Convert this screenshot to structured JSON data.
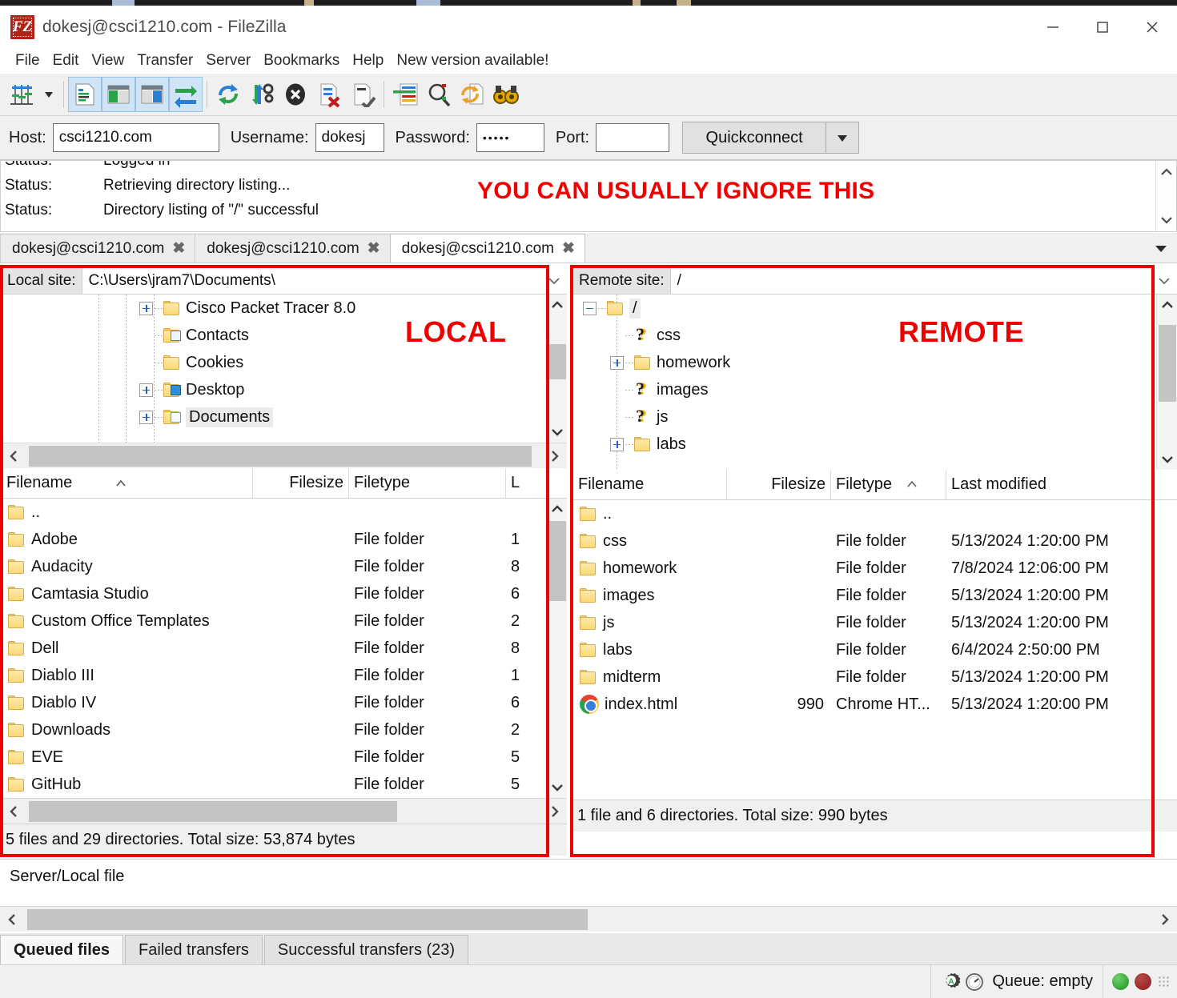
{
  "window": {
    "title": "dokesj@csci1210.com - FileZilla",
    "logo_text": "FZ",
    "minimize": "minimize-icon",
    "maximize": "maximize-icon",
    "close": "close-icon"
  },
  "menu": {
    "items": [
      "File",
      "Edit",
      "View",
      "Transfer",
      "Server",
      "Bookmarks",
      "Help",
      "New version available!"
    ]
  },
  "toolbar": {
    "icons": [
      "site-manager-icon",
      "site-manager-dropdown-caret",
      "toggle-message-log-icon",
      "toggle-local-tree-icon",
      "toggle-remote-tree-icon",
      "toggle-transfer-queue-icon",
      "refresh-icon",
      "process-queue-icon",
      "cancel-icon",
      "disconnect-icon",
      "reconnect-icon",
      "filter-icon",
      "compare-directories-icon",
      "synchronized-browsing-icon",
      "find-files-icon"
    ]
  },
  "quickconnect": {
    "host_label": "Host:",
    "host_value": "csci1210.com",
    "username_label": "Username:",
    "username_value": "dokesj",
    "password_label": "Password:",
    "password_value": "•••••",
    "port_label": "Port:",
    "port_value": "",
    "port_placeholder": "",
    "button_label": "Quickconnect",
    "dropdown_icon": "chevron-down-icon"
  },
  "status_log": {
    "rows": [
      {
        "key": "Status:",
        "msg": "Logged in"
      },
      {
        "key": "Status:",
        "msg": "Retrieving directory listing..."
      },
      {
        "key": "Status:",
        "msg": "Directory listing of \"/\" successful"
      }
    ],
    "annotation": "YOU CAN USUALLY IGNORE THIS",
    "annotation_color": "#f20000"
  },
  "tabs": {
    "items": [
      {
        "label": "dokesj@csci1210.com",
        "active": false
      },
      {
        "label": "dokesj@csci1210.com",
        "active": false
      },
      {
        "label": "dokesj@csci1210.com",
        "active": true
      }
    ],
    "close_icon": "close-tab-icon",
    "overflow_icon": "chevron-down-icon"
  },
  "local": {
    "annotation": "LOCAL",
    "site_label": "Local site:",
    "site_value": "C:\\Users\\jram7\\Documents\\",
    "tree": [
      {
        "label": "Cisco Packet Tracer 8.0",
        "expander": "plus",
        "icon": "folder-icon",
        "selected": false
      },
      {
        "label": "Contacts",
        "expander": "none",
        "icon": "folder-contacts-icon",
        "selected": false
      },
      {
        "label": "Cookies",
        "expander": "none",
        "icon": "folder-icon",
        "selected": false
      },
      {
        "label": "Desktop",
        "expander": "plus",
        "icon": "folder-desktop-icon",
        "selected": false
      },
      {
        "label": "Documents",
        "expander": "plus",
        "icon": "folder-documents-icon",
        "selected": true
      }
    ],
    "columns": [
      "Filename",
      "Filesize",
      "Filetype",
      "L"
    ],
    "sort_indicator": "sort-ascending-icon",
    "rows": [
      {
        "name": "..",
        "size": "",
        "type": "",
        "last": ""
      },
      {
        "name": "Adobe",
        "size": "",
        "type": "File folder",
        "last": "1"
      },
      {
        "name": "Audacity",
        "size": "",
        "type": "File folder",
        "last": "8"
      },
      {
        "name": "Camtasia Studio",
        "size": "",
        "type": "File folder",
        "last": "6"
      },
      {
        "name": "Custom Office Templates",
        "size": "",
        "type": "File folder",
        "last": "2"
      },
      {
        "name": "Dell",
        "size": "",
        "type": "File folder",
        "last": "8"
      },
      {
        "name": "Diablo III",
        "size": "",
        "type": "File folder",
        "last": "1"
      },
      {
        "name": "Diablo IV",
        "size": "",
        "type": "File folder",
        "last": "6"
      },
      {
        "name": "Downloads",
        "size": "",
        "type": "File folder",
        "last": "2"
      },
      {
        "name": "EVE",
        "size": "",
        "type": "File folder",
        "last": "5"
      },
      {
        "name": "GitHub",
        "size": "",
        "type": "File folder",
        "last": "5"
      }
    ],
    "status": "5 files and 29 directories. Total size: 53,874 bytes"
  },
  "remote": {
    "annotation": "REMOTE",
    "site_label": "Remote site:",
    "site_value": "/",
    "tree": [
      {
        "label": "/",
        "expander": "minus",
        "icon": "folder-icon",
        "selected": true
      },
      {
        "label": "css",
        "expander": "none",
        "icon": "unknown-icon",
        "selected": false
      },
      {
        "label": "homework",
        "expander": "plus",
        "icon": "folder-icon",
        "selected": false
      },
      {
        "label": "images",
        "expander": "none",
        "icon": "unknown-icon",
        "selected": false
      },
      {
        "label": "js",
        "expander": "none",
        "icon": "unknown-icon",
        "selected": false
      },
      {
        "label": "labs",
        "expander": "plus",
        "icon": "folder-icon",
        "selected": false
      }
    ],
    "columns": [
      "Filename",
      "Filesize",
      "Filetype",
      "Last modified"
    ],
    "sort_indicator": "sort-ascending-icon",
    "rows": [
      {
        "name": "..",
        "size": "",
        "type": "",
        "last": ""
      },
      {
        "name": "css",
        "size": "",
        "type": "File folder",
        "last": "5/13/2024 1:20:00 PM"
      },
      {
        "name": "homework",
        "size": "",
        "type": "File folder",
        "last": "7/8/2024 12:06:00 PM"
      },
      {
        "name": "images",
        "size": "",
        "type": "File folder",
        "last": "5/13/2024 1:20:00 PM"
      },
      {
        "name": "js",
        "size": "",
        "type": "File folder",
        "last": "5/13/2024 1:20:00 PM"
      },
      {
        "name": "labs",
        "size": "",
        "type": "File folder",
        "last": "6/4/2024 2:50:00 PM"
      },
      {
        "name": "midterm",
        "size": "",
        "type": "File folder",
        "last": "5/13/2024 1:20:00 PM"
      },
      {
        "name": "index.html",
        "size": "990",
        "type": "Chrome HT...",
        "last": "5/13/2024 1:20:00 PM"
      }
    ],
    "status": "1 file and 6 directories. Total size: 990 bytes"
  },
  "transfer_queue": {
    "header": "Server/Local file",
    "tabs": [
      {
        "label": "Queued files",
        "active": true
      },
      {
        "label": "Failed transfers",
        "active": false
      },
      {
        "label": "Successful transfers (23)",
        "active": false
      }
    ]
  },
  "statusbar": {
    "auto_icon": "auto-transfer-gear-icon",
    "speed_icon": "speed-limit-icon",
    "queue_text": "Queue: empty",
    "led_green": "#2d9b2d",
    "led_red": "#9b2020",
    "grip": "resize-grip-icon"
  },
  "annotation_color": "#ef0000"
}
